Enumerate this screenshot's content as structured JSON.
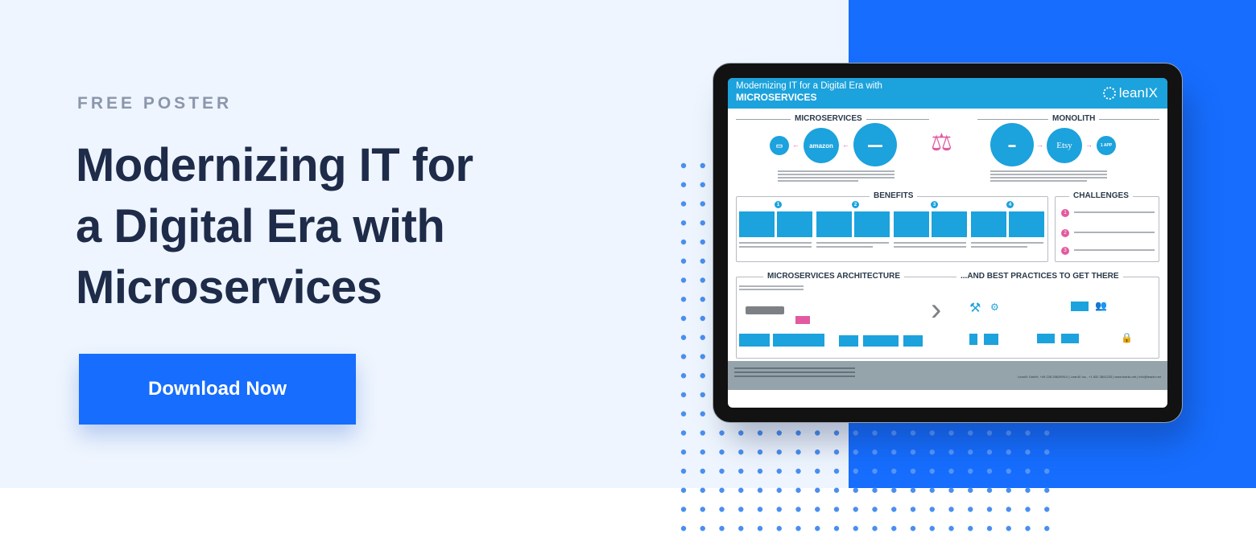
{
  "hero": {
    "eyebrow": "FREE POSTER",
    "headline_lines": [
      "Modernizing IT for",
      "a Digital Era with",
      "Microservices"
    ],
    "cta_label": "Download Now"
  },
  "colors": {
    "page_bg": "#eef5fe",
    "accent_blue": "#166dfe",
    "headline": "#1e2b49",
    "eyebrow": "#8c96ab",
    "dot": "#4a8ff0",
    "poster_blue": "#1ca2dc",
    "poster_pink": "#e25aa0"
  },
  "poster": {
    "title_line1": "Modernizing IT for a Digital Era with",
    "title_line2": "MICROSERVICES",
    "brand": "leanIX",
    "sections": {
      "microservices": "MICROSERVICES",
      "monolith": "MONOLITH",
      "benefits": "BENEFITS",
      "challenges": "CHALLENGES",
      "architecture": "MICROSERVICES ARCHITECTURE",
      "best_practices": "...AND BEST PRACTICES TO GET THERE"
    },
    "microservices_flow": [
      "monitor",
      "amazon",
      "delivery-vans"
    ],
    "monolith_flow": [
      "truck",
      "Etsy",
      "1 APP"
    ],
    "benefit_steps": [
      "1",
      "2",
      "3",
      "4"
    ],
    "challenge_steps": [
      "1",
      "2",
      "3"
    ],
    "footer_contact": "LeanIX GmbH, +49 228 2862995-0 | LeanIX Inc., +1 832 3841233 | www.leanix.net | info@leanix.net"
  }
}
